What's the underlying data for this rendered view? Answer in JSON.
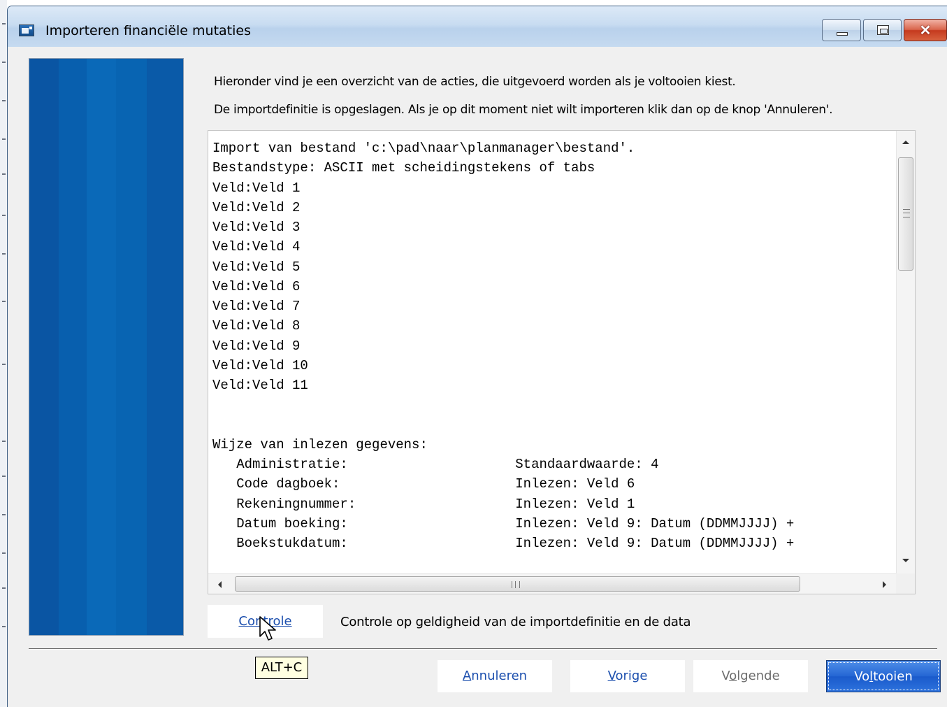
{
  "window": {
    "title": "Importeren financiële mutaties",
    "controls": {
      "minimize": "minimize-icon",
      "maximize": "maximize-icon",
      "close": "close-icon"
    }
  },
  "intro": {
    "line1": "Hieronder vind je een overzicht van de acties, die uitgevoerd worden als je voltooien kiest.",
    "line2": "De importdefinitie is opgeslagen. Als je op dit moment niet wilt importeren klik dan op de knop 'Annuleren'."
  },
  "summary": {
    "lines": [
      "Import van bestand 'c:\\pad\\naar\\planmanager\\bestand'.",
      "Bestandstype: ASCII met scheidingstekens of tabs",
      "Veld:Veld 1",
      "Veld:Veld 2",
      "Veld:Veld 3",
      "Veld:Veld 4",
      "Veld:Veld 5",
      "Veld:Veld 6",
      "Veld:Veld 7",
      "Veld:Veld 8",
      "Veld:Veld 9",
      "Veld:Veld 10",
      "Veld:Veld 11",
      "",
      "",
      "Wijze van inlezen gegevens:",
      "   Administratie:                     Standaardwaarde: 4",
      "   Code dagboek:                      Inlezen: Veld 6",
      "   Rekeningnummer:                    Inlezen: Veld 1",
      "   Datum boeking:                     Inlezen: Veld 9: Datum (DDMMJJJJ) +",
      "   Boekstukdatum:                     Inlezen: Veld 9: Datum (DDMMJJJJ) +"
    ]
  },
  "check": {
    "button_label": "Controle",
    "description": "Controle op geldigheid van de importdefinitie en de data"
  },
  "footer": {
    "cancel_label": "Annuleren",
    "previous_label": "Vorige",
    "next_label": "Volgende",
    "finish_label": "Voltooien"
  },
  "tooltip": {
    "text": "ALT+C"
  },
  "colors": {
    "banner_blue": "#0a5aa8",
    "link_blue": "#1c4fae",
    "default_button": "#2466d4",
    "tooltip_bg": "#ffffe1"
  }
}
